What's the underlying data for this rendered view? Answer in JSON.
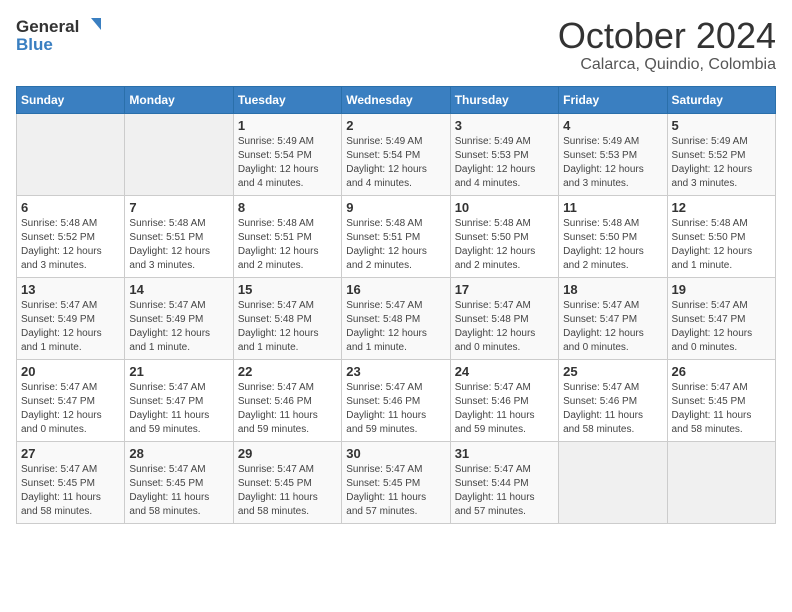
{
  "logo": {
    "general": "General",
    "blue": "Blue"
  },
  "title": "October 2024",
  "location": "Calarca, Quindio, Colombia",
  "weekdays": [
    "Sunday",
    "Monday",
    "Tuesday",
    "Wednesday",
    "Thursday",
    "Friday",
    "Saturday"
  ],
  "weeks": [
    [
      {
        "day": "",
        "info": ""
      },
      {
        "day": "",
        "info": ""
      },
      {
        "day": "1",
        "info": "Sunrise: 5:49 AM\nSunset: 5:54 PM\nDaylight: 12 hours\nand 4 minutes."
      },
      {
        "day": "2",
        "info": "Sunrise: 5:49 AM\nSunset: 5:54 PM\nDaylight: 12 hours\nand 4 minutes."
      },
      {
        "day": "3",
        "info": "Sunrise: 5:49 AM\nSunset: 5:53 PM\nDaylight: 12 hours\nand 4 minutes."
      },
      {
        "day": "4",
        "info": "Sunrise: 5:49 AM\nSunset: 5:53 PM\nDaylight: 12 hours\nand 3 minutes."
      },
      {
        "day": "5",
        "info": "Sunrise: 5:49 AM\nSunset: 5:52 PM\nDaylight: 12 hours\nand 3 minutes."
      }
    ],
    [
      {
        "day": "6",
        "info": "Sunrise: 5:48 AM\nSunset: 5:52 PM\nDaylight: 12 hours\nand 3 minutes."
      },
      {
        "day": "7",
        "info": "Sunrise: 5:48 AM\nSunset: 5:51 PM\nDaylight: 12 hours\nand 3 minutes."
      },
      {
        "day": "8",
        "info": "Sunrise: 5:48 AM\nSunset: 5:51 PM\nDaylight: 12 hours\nand 2 minutes."
      },
      {
        "day": "9",
        "info": "Sunrise: 5:48 AM\nSunset: 5:51 PM\nDaylight: 12 hours\nand 2 minutes."
      },
      {
        "day": "10",
        "info": "Sunrise: 5:48 AM\nSunset: 5:50 PM\nDaylight: 12 hours\nand 2 minutes."
      },
      {
        "day": "11",
        "info": "Sunrise: 5:48 AM\nSunset: 5:50 PM\nDaylight: 12 hours\nand 2 minutes."
      },
      {
        "day": "12",
        "info": "Sunrise: 5:48 AM\nSunset: 5:50 PM\nDaylight: 12 hours\nand 1 minute."
      }
    ],
    [
      {
        "day": "13",
        "info": "Sunrise: 5:47 AM\nSunset: 5:49 PM\nDaylight: 12 hours\nand 1 minute."
      },
      {
        "day": "14",
        "info": "Sunrise: 5:47 AM\nSunset: 5:49 PM\nDaylight: 12 hours\nand 1 minute."
      },
      {
        "day": "15",
        "info": "Sunrise: 5:47 AM\nSunset: 5:48 PM\nDaylight: 12 hours\nand 1 minute."
      },
      {
        "day": "16",
        "info": "Sunrise: 5:47 AM\nSunset: 5:48 PM\nDaylight: 12 hours\nand 1 minute."
      },
      {
        "day": "17",
        "info": "Sunrise: 5:47 AM\nSunset: 5:48 PM\nDaylight: 12 hours\nand 0 minutes."
      },
      {
        "day": "18",
        "info": "Sunrise: 5:47 AM\nSunset: 5:47 PM\nDaylight: 12 hours\nand 0 minutes."
      },
      {
        "day": "19",
        "info": "Sunrise: 5:47 AM\nSunset: 5:47 PM\nDaylight: 12 hours\nand 0 minutes."
      }
    ],
    [
      {
        "day": "20",
        "info": "Sunrise: 5:47 AM\nSunset: 5:47 PM\nDaylight: 12 hours\nand 0 minutes."
      },
      {
        "day": "21",
        "info": "Sunrise: 5:47 AM\nSunset: 5:47 PM\nDaylight: 11 hours\nand 59 minutes."
      },
      {
        "day": "22",
        "info": "Sunrise: 5:47 AM\nSunset: 5:46 PM\nDaylight: 11 hours\nand 59 minutes."
      },
      {
        "day": "23",
        "info": "Sunrise: 5:47 AM\nSunset: 5:46 PM\nDaylight: 11 hours\nand 59 minutes."
      },
      {
        "day": "24",
        "info": "Sunrise: 5:47 AM\nSunset: 5:46 PM\nDaylight: 11 hours\nand 59 minutes."
      },
      {
        "day": "25",
        "info": "Sunrise: 5:47 AM\nSunset: 5:46 PM\nDaylight: 11 hours\nand 58 minutes."
      },
      {
        "day": "26",
        "info": "Sunrise: 5:47 AM\nSunset: 5:45 PM\nDaylight: 11 hours\nand 58 minutes."
      }
    ],
    [
      {
        "day": "27",
        "info": "Sunrise: 5:47 AM\nSunset: 5:45 PM\nDaylight: 11 hours\nand 58 minutes."
      },
      {
        "day": "28",
        "info": "Sunrise: 5:47 AM\nSunset: 5:45 PM\nDaylight: 11 hours\nand 58 minutes."
      },
      {
        "day": "29",
        "info": "Sunrise: 5:47 AM\nSunset: 5:45 PM\nDaylight: 11 hours\nand 58 minutes."
      },
      {
        "day": "30",
        "info": "Sunrise: 5:47 AM\nSunset: 5:45 PM\nDaylight: 11 hours\nand 57 minutes."
      },
      {
        "day": "31",
        "info": "Sunrise: 5:47 AM\nSunset: 5:44 PM\nDaylight: 11 hours\nand 57 minutes."
      },
      {
        "day": "",
        "info": ""
      },
      {
        "day": "",
        "info": ""
      }
    ]
  ]
}
